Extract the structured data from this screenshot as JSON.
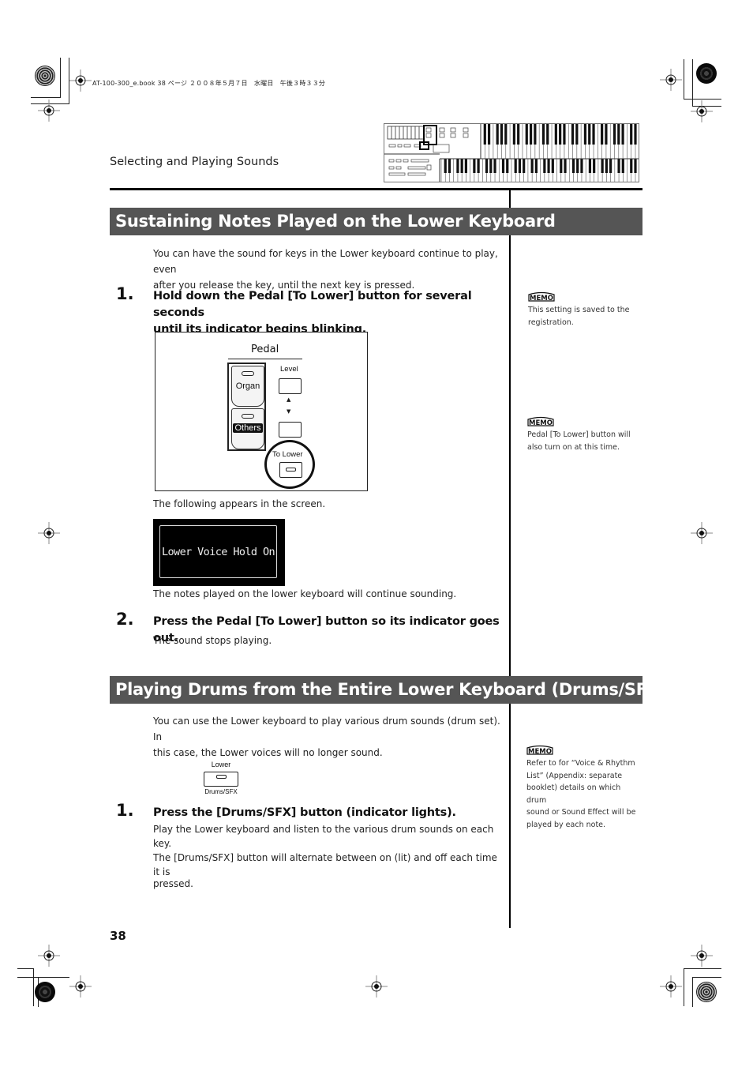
{
  "print_header": {
    "file_info": "AT-100-300_e.book  38 ページ  ２００８年５月７日　水曜日　午後３時３３分"
  },
  "running_head": "Selecting and Playing Sounds",
  "page_number": "38",
  "sections": [
    {
      "title": "Sustaining Notes Played on the Lower Keyboard",
      "intro": "You can have the sound for keys in the Lower keyboard continue to play, even after you release the key, until the next key is pressed.",
      "intro_lines": [
        "You can have the sound for keys in the Lower keyboard continue to play, even",
        "after you release the key, until the next key is pressed."
      ],
      "steps": [
        {
          "number": "1.",
          "lines": [
            "Hold down the Pedal [To Lower] button for several seconds",
            "until its indicator begins blinking."
          ]
        },
        {
          "number": "2.",
          "lines": [
            "Press the Pedal [To Lower] button so its indicator goes out."
          ]
        }
      ],
      "figure_pedal": {
        "heading": "Pedal",
        "buttons": {
          "organ": "Organ",
          "others": "Others",
          "level": "Level",
          "to_lower": "To Lower"
        },
        "arrows": {
          "up": "▲",
          "down": "▼"
        }
      },
      "screen_caption": "The following appears in the screen.",
      "lcd_text": "Lower Voice Hold On",
      "after_lcd": "The notes played on the lower keyboard will continue sounding.",
      "after_step2": "The sound stops playing."
    },
    {
      "title": "Playing Drums from the Entire Lower Keyboard (Drums/SFX)",
      "intro_lines": [
        "You can use the Lower keyboard to play various drum sounds (drum set). In",
        "this case, the Lower voices will no longer sound."
      ],
      "figure_button": {
        "top_label": "Lower",
        "bottom_label": "Drums/SFX"
      },
      "steps": [
        {
          "number": "1.",
          "lines": [
            "Press the [Drums/SFX] button (indicator lights)."
          ],
          "body_lines": [
            "Play the Lower keyboard and listen to the various drum sounds on each key.",
            "The [Drums/SFX] button will alternate between on (lit) and off each time it is",
            "pressed."
          ]
        }
      ]
    }
  ],
  "memos": [
    {
      "icon": "memo-icon",
      "label": "MEMO",
      "lines": [
        "This setting is saved to the",
        "registration."
      ]
    },
    {
      "icon": "memo-icon",
      "label": "MEMO",
      "lines": [
        "Pedal [To Lower] button will",
        "also turn on at this time."
      ]
    },
    {
      "icon": "memo-icon",
      "label": "MEMO",
      "lines": [
        "Refer to for “Voice & Rhythm",
        "List” (Appendix: separate",
        "booklet) details on which drum",
        "sound or Sound Effect will be",
        "played by each note."
      ]
    }
  ],
  "colors": {
    "section_bar": "#555555",
    "text": "#222222",
    "lcd_bg": "#000000"
  }
}
